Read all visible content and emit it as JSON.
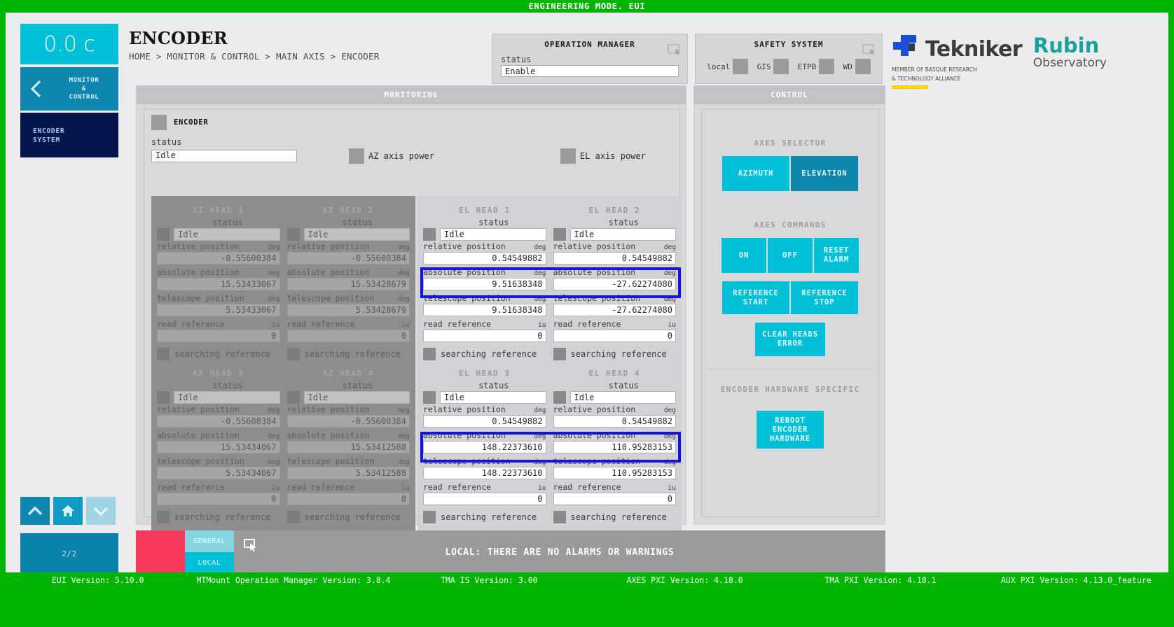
{
  "topbar": {
    "text": "ENGINEERING MODE. EUI"
  },
  "sidebar": {
    "temperature": "0.0 c",
    "nav_monitor": "MONITOR\n&\nCONTROL",
    "nav_monitor_l1": "MONITOR",
    "nav_monitor_l2": "&",
    "nav_monitor_l3": "CONTROL",
    "nav_encoder_l1": "ENCODER",
    "nav_encoder_l2": "SYSTEM",
    "page_indicator": "2/2",
    "icons": {
      "up": "chevron-up-icon",
      "home": "home-icon",
      "down": "chevron-down-icon",
      "back": "chevron-left-icon"
    }
  },
  "header": {
    "title": "ENCODER",
    "breadcrumb": "HOME > MONITOR & CONTROL > MAIN AXIS > ENCODER"
  },
  "operation_manager": {
    "title": "OPERATION MANAGER",
    "status_label": "status",
    "status_value": "Enable"
  },
  "safety_system": {
    "title": "SAFETY SYSTEM",
    "indicators": [
      {
        "label": "local",
        "state": "off"
      },
      {
        "label": "GIS",
        "state": "off"
      },
      {
        "label": "ETPB",
        "state": "off"
      },
      {
        "label": "WD",
        "state": "off"
      }
    ]
  },
  "logos": {
    "tekniker_name": "Tekniker",
    "tekniker_sub_l1": "MEMBER OF BASQUE RESEARCH",
    "tekniker_sub_l2": "& TECHNOLOGY ALLIANCE",
    "rubin_l1": "Rubin",
    "rubin_l2": "Observatory"
  },
  "monitoring": {
    "section_title": "MONITORING",
    "encoder_card_title": "ENCODER",
    "status_label": "status",
    "status_value": "Idle",
    "az_axis_power_label": "AZ axis power",
    "el_axis_power_label": "EL axis power",
    "field_labels": {
      "status": "status",
      "relative_position": "relative position",
      "absolute_position": "absolute position",
      "telescope_position": "telescope position",
      "read_reference": "read reference",
      "searching_reference": "searching reference"
    },
    "units": {
      "deg": "deg",
      "iu": "iu"
    },
    "az_heads": [
      {
        "title": "AZ HEAD 1",
        "status": "Idle",
        "relative_position": "-0.55600384",
        "absolute_position": "15.53433067",
        "telescope_position": "5.53433067",
        "read_reference": "0"
      },
      {
        "title": "AZ HEAD 2",
        "status": "Idle",
        "relative_position": "-0.55600384",
        "absolute_position": "15.53428679",
        "telescope_position": "5.53428679",
        "read_reference": "0"
      },
      {
        "title": "AZ HEAD 3",
        "status": "Idle",
        "relative_position": "-0.55600384",
        "absolute_position": "15.53434067",
        "telescope_position": "5.53434067",
        "read_reference": "0"
      },
      {
        "title": "AZ HEAD 4",
        "status": "Idle",
        "relative_position": "-0.55600384",
        "absolute_position": "15.53412588",
        "telescope_position": "5.53412588",
        "read_reference": "0"
      }
    ],
    "el_heads": [
      {
        "title": "EL HEAD 1",
        "status": "Idle",
        "relative_position": "0.54549882",
        "absolute_position": "9.51638348",
        "telescope_position": "9.51638348",
        "read_reference": "0"
      },
      {
        "title": "EL HEAD 2",
        "status": "Idle",
        "relative_position": "0.54549882",
        "absolute_position": "-27.62274080",
        "telescope_position": "-27.62274080",
        "read_reference": "0"
      },
      {
        "title": "EL HEAD 3",
        "status": "Idle",
        "relative_position": "0.54549882",
        "absolute_position": "148.22373610",
        "telescope_position": "148.22373610",
        "read_reference": "0"
      },
      {
        "title": "EL HEAD 4",
        "status": "Idle",
        "relative_position": "0.54549882",
        "absolute_position": "110.95283153",
        "telescope_position": "110.95283153",
        "read_reference": "0"
      }
    ]
  },
  "control": {
    "section_title": "CONTROL",
    "axes_selector_label": "AXES SELECTOR",
    "axes_selector": [
      {
        "label": "AZIMUTH",
        "selected": false
      },
      {
        "label": "ELEVATION",
        "selected": true
      }
    ],
    "axes_commands_label": "AXES COMMANDS",
    "commands_row1": [
      "ON",
      "OFF",
      "RESET\nALARM"
    ],
    "cmd_on": "ON",
    "cmd_off": "OFF",
    "cmd_reset_l1": "RESET",
    "cmd_reset_l2": "ALARM",
    "cmd_ref_start_l1": "REFERENCE",
    "cmd_ref_start_l2": "START",
    "cmd_ref_stop_l1": "REFERENCE",
    "cmd_ref_stop_l2": "STOP",
    "cmd_clear_l1": "CLEAR HEADS",
    "cmd_clear_l2": "ERROR",
    "hardware_specific_label": "ENCODER HARDWARE SPECIFIC",
    "cmd_reboot_l1": "REBOOT",
    "cmd_reboot_l2": "ENCODER",
    "cmd_reboot_l3": "HARDWARE"
  },
  "alarm_bar": {
    "tab_general": "GENERAL",
    "tab_local": "LOCAL",
    "message": "LOCAL: THERE ARE NO ALARMS OR WARNINGS"
  },
  "versions": {
    "eui": "EUI Version: 5.10.0",
    "opmanager": "MTMount Operation Manager Version: 3.8.4",
    "tma_is": "TMA IS Version: 3.00",
    "axes_pxi": "AXES PXI Version: 4.18.0",
    "tma_pxi": "TMA PXI Version: 4.18.1",
    "aux_pxi": "AUX PXI Version: 4.13.0_feature"
  },
  "colors": {
    "brand_green": "#00b400",
    "cyan": "#00c0d8",
    "cyan_dark": "#0f86ad",
    "navy": "#04154b",
    "alarm_red": "#fb3b5e",
    "highlight_blue": "#1414dc"
  }
}
